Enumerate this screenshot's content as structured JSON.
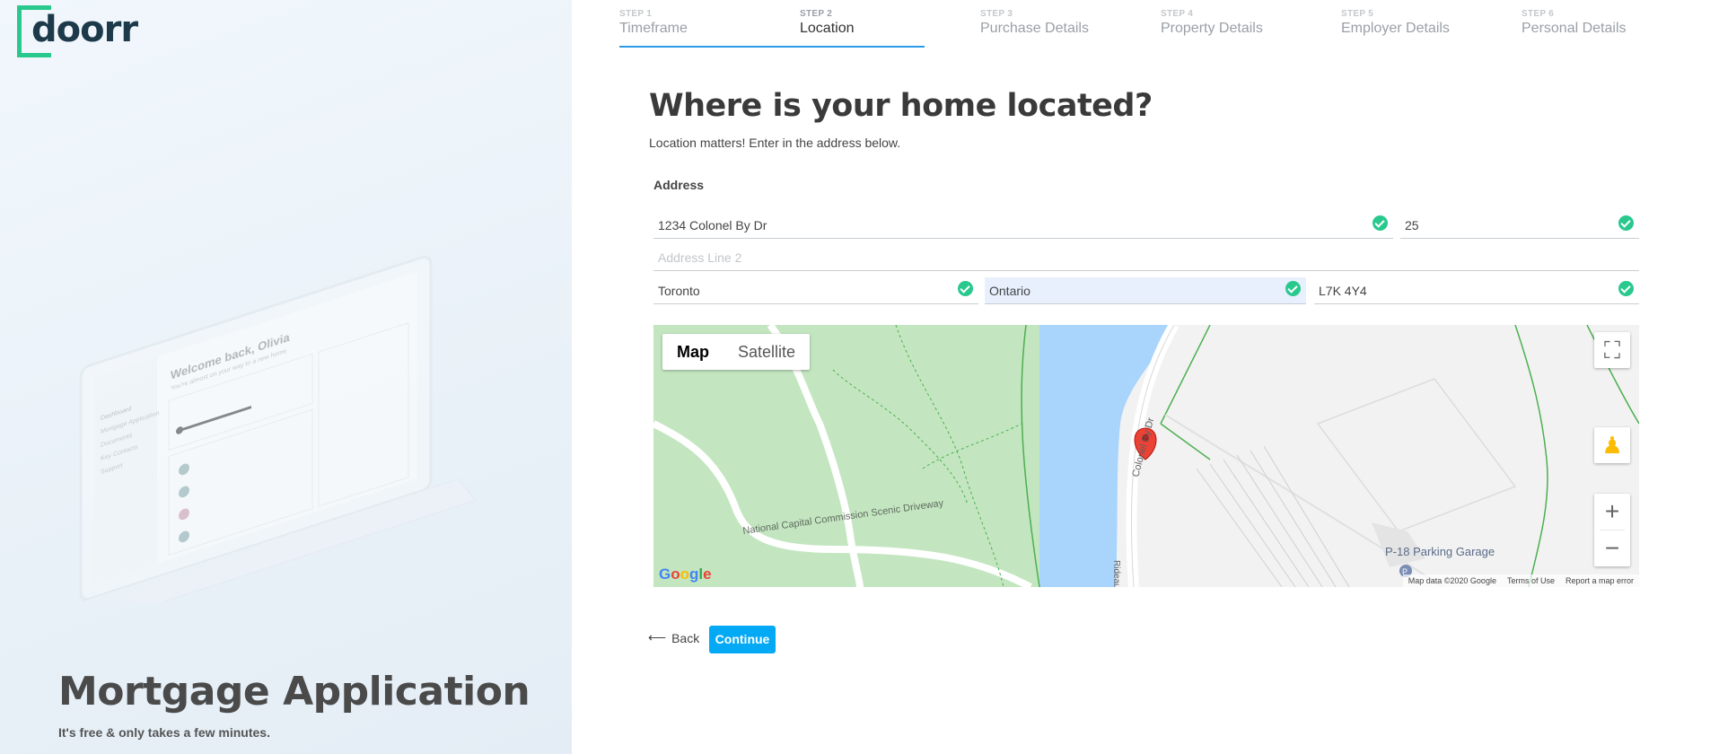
{
  "brand": {
    "logo_text": "doorr"
  },
  "hero": {
    "title": "Mortgage Application",
    "subtitle": "It's free & only takes a few minutes."
  },
  "laptop_preview": {
    "welcome": "Welcome back, Olivia",
    "welcome_sub": "You're almost on your way to a new home",
    "nav": [
      "Dashboard",
      "Mortgage Application",
      "Documents",
      "Key Contacts",
      "Support"
    ]
  },
  "steps": [
    {
      "num": "STEP 1",
      "label": "Timeframe"
    },
    {
      "num": "STEP 2",
      "label": "Location"
    },
    {
      "num": "STEP 3",
      "label": "Purchase Details"
    },
    {
      "num": "STEP 4",
      "label": "Property Details"
    },
    {
      "num": "STEP 5",
      "label": "Employer Details"
    },
    {
      "num": "STEP 6",
      "label": "Personal Details"
    }
  ],
  "active_step": 2,
  "form": {
    "title": "Where is your home located?",
    "subtitle": "Location matters! Enter in the address below.",
    "address_label": "Address",
    "street": "1234 Colonel By Dr",
    "unit": "25",
    "address2_placeholder": "Address Line 2",
    "city": "Toronto",
    "province": "Ontario",
    "postal": "L7K 4Y4"
  },
  "map": {
    "type_map": "Map",
    "type_satellite": "Satellite",
    "road_label_1": "National Capital Commission Scenic Driveway",
    "road_label_2": "Colonel By Dr",
    "road_label_3": "Rideau",
    "parking_label": "P-18 Parking Garage",
    "footer_data": "Map data ©2020 Google",
    "footer_terms": "Terms of Use",
    "footer_report": "Report a map error",
    "google_letters": [
      "G",
      "o",
      "o",
      "g",
      "l",
      "e"
    ]
  },
  "actions": {
    "back": "Back",
    "continue": "Continue"
  },
  "colors": {
    "accent": "#03a9f4",
    "step_line": "#2b9be8",
    "check": "#29c98e",
    "logo": "#29c98e"
  }
}
